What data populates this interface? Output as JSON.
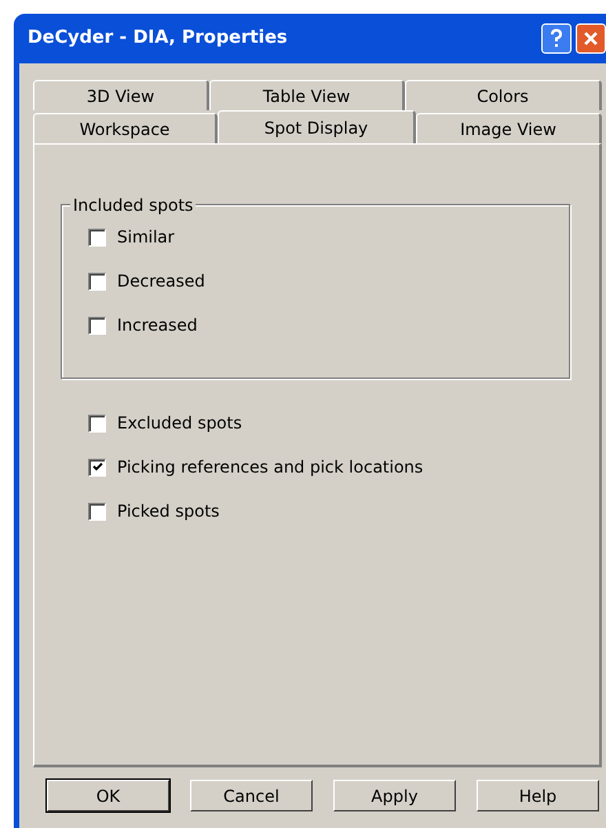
{
  "window": {
    "title": "DeCyder - DIA, Properties"
  },
  "tab_rows": [
    [
      {
        "label": "3D View",
        "selected": false
      },
      {
        "label": "Table View",
        "selected": false
      },
      {
        "label": "Colors",
        "selected": false
      }
    ],
    [
      {
        "label": "Workspace",
        "selected": false
      },
      {
        "label": "Spot Display",
        "selected": true
      },
      {
        "label": "Image View",
        "selected": false
      }
    ]
  ],
  "group": {
    "title": "Included spots",
    "options": [
      {
        "label": "Similar",
        "checked": false
      },
      {
        "label": "Decreased",
        "checked": false
      },
      {
        "label": "Increased",
        "checked": false
      }
    ]
  },
  "options": [
    {
      "label": "Excluded spots",
      "checked": false
    },
    {
      "label": "Picking references and pick locations",
      "checked": true
    },
    {
      "label": "Picked spots",
      "checked": false
    }
  ],
  "buttons": [
    {
      "label": "OK",
      "default": true
    },
    {
      "label": "Cancel",
      "default": false
    },
    {
      "label": "Apply",
      "default": false
    },
    {
      "label": "Help",
      "default": false
    }
  ]
}
